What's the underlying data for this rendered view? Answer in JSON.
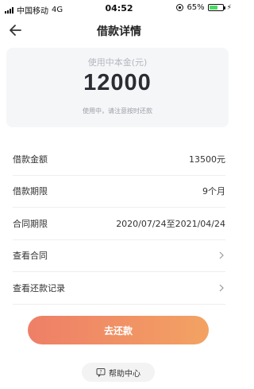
{
  "status": {
    "carrier": "中国移动",
    "network": "4G",
    "time": "04:52",
    "battery": "65%"
  },
  "nav": {
    "title": "借款详情",
    "back_icon": "arrow-left-icon"
  },
  "summary": {
    "label": "使用中本金(元)",
    "amount": "12000",
    "note": "使用中，请注意按时还款"
  },
  "details": [
    {
      "key": "借款金额",
      "value": "13500元"
    },
    {
      "key": "借款期限",
      "value": "9个月"
    },
    {
      "key": "合同期限",
      "value": "2020/07/24至2021/04/24"
    },
    {
      "key": "查看合同",
      "value": ""
    },
    {
      "key": "查看还款记录",
      "value": ""
    }
  ],
  "actions": {
    "repay_label": "去还款",
    "help_label": "帮助中心"
  },
  "colors": {
    "accent_start": "#ee7f67",
    "accent_end": "#f3a263",
    "card_bg": "#f5f6f8"
  }
}
